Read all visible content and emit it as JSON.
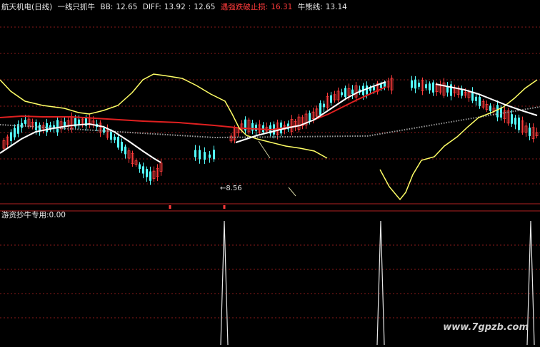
{
  "header": {
    "stock": "航天机电(日线)",
    "indicator": "一线只抓牛",
    "bb_label": "BB:",
    "bb_value": "12.65",
    "diff_label": "DIFF:",
    "diff_value": "13.92",
    "sep": ":",
    "diff_value2": "12.65",
    "stop_label": "遇强跌破止损:",
    "stop_value": "16.31",
    "bull_label": "牛熊线:",
    "bull_value": "13.14"
  },
  "sub_panel": {
    "label": "游资抄牛专用",
    "sep": ":",
    "value": "0.00"
  },
  "annotation": "←8.56",
  "watermark": "www.7gpzb.com",
  "colors": {
    "background": "#000000",
    "up_candle": "#ff3b3b",
    "down_candle": "#54ffff",
    "yellow_line": "#ffff66",
    "white_line": "#ffffff",
    "red_line": "#e02020",
    "gray_dots": "#9a9a9a",
    "grid": "#8b1a1a"
  },
  "chart_data": [
    {
      "type": "line",
      "panel": "main",
      "series_lines": [
        "yellow",
        "white",
        "red",
        "gray-dotted",
        "candlesticks"
      ],
      "grid": true,
      "notes": "candlestick chart with overlay lines; values shown in header only"
    },
    {
      "type": "bar",
      "panel": "sub",
      "spikes_x_fraction": [
        0.415,
        0.705,
        0.983
      ],
      "value": 0.0
    }
  ]
}
